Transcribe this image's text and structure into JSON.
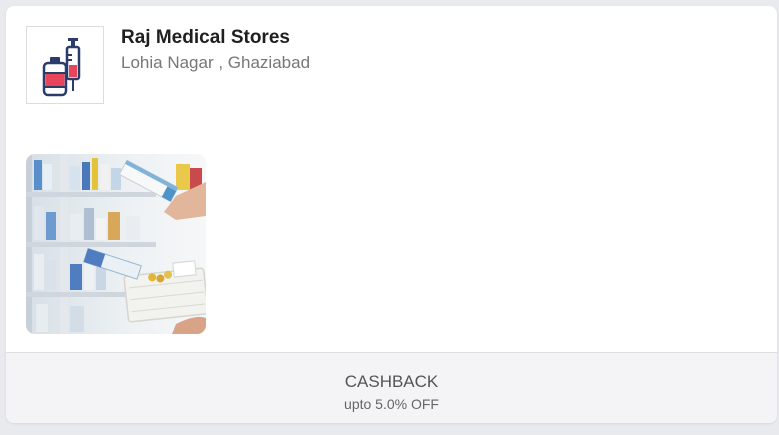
{
  "store": {
    "name": "Raj Medical Stores",
    "location": "Lohia Nagar , Ghaziabad",
    "logo_icon": "medicine-vial-syringe-icon",
    "photo": "pharmacy-shelf-photo"
  },
  "offer": {
    "title": "CASHBACK",
    "subtitle": "upto 5.0% OFF"
  },
  "colors": {
    "accent_red": "#e8455b",
    "icon_navy": "#2b3b6b",
    "footer_bg": "#f4f4f6"
  }
}
